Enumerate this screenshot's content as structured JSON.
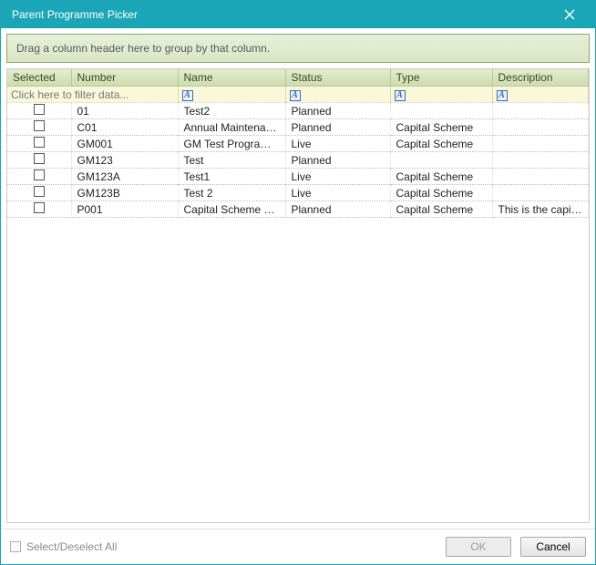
{
  "window": {
    "title": "Parent Programme Picker"
  },
  "groupbox": {
    "hint": "Drag a column header here to group by that column."
  },
  "columns": {
    "selected": "Selected",
    "number": "Number",
    "name": "Name",
    "status": "Status",
    "type": "Type",
    "description": "Description"
  },
  "filter_hint": "Click here to filter data...",
  "rows": [
    {
      "number": "01",
      "name": "Test2",
      "status": "Planned",
      "type": "",
      "description": ""
    },
    {
      "number": "C01",
      "name": "Annual  Maintenanc..",
      "status": "Planned",
      "type": "Capital Scheme",
      "description": ""
    },
    {
      "number": "GM001",
      "name": "GM Test Programme",
      "status": "Live",
      "type": "Capital Scheme",
      "description": ""
    },
    {
      "number": "GM123",
      "name": "Test",
      "status": "Planned",
      "type": "",
      "description": ""
    },
    {
      "number": "GM123A",
      "name": "Test1",
      "status": "Live",
      "type": "Capital Scheme",
      "description": ""
    },
    {
      "number": "GM123B",
      "name": "Test 2",
      "status": "Live",
      "type": "Capital Scheme",
      "description": ""
    },
    {
      "number": "P001",
      "name": "Capital  Scheme  Pro...",
      "status": "Planned",
      "type": "Capital Scheme",
      "description": "This is the capital s..."
    }
  ],
  "footer": {
    "select_all": "Select/Deselect All",
    "ok": "OK",
    "cancel": "Cancel"
  }
}
